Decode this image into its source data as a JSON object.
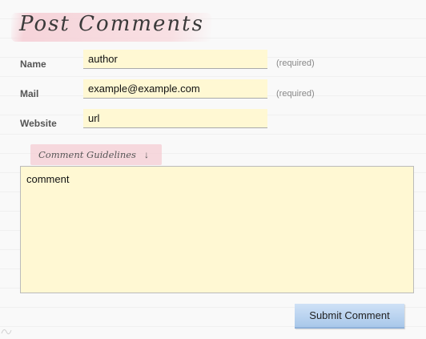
{
  "form": {
    "title": "Post Comments",
    "name_label": "Name",
    "name_value": "author",
    "mail_label": "Mail",
    "mail_value": "example@example.com",
    "website_label": "Website",
    "website_value": "url",
    "required_note": "(required)",
    "guidelines_label": "Comment Guidelines",
    "guidelines_arrow": "↓",
    "comment_value": "comment",
    "submit_label": "Submit Comment"
  },
  "colors": {
    "field_bg": "#fff8d3",
    "title_highlight": "#f5cdd4",
    "button_bg": "#a9c8ea"
  }
}
